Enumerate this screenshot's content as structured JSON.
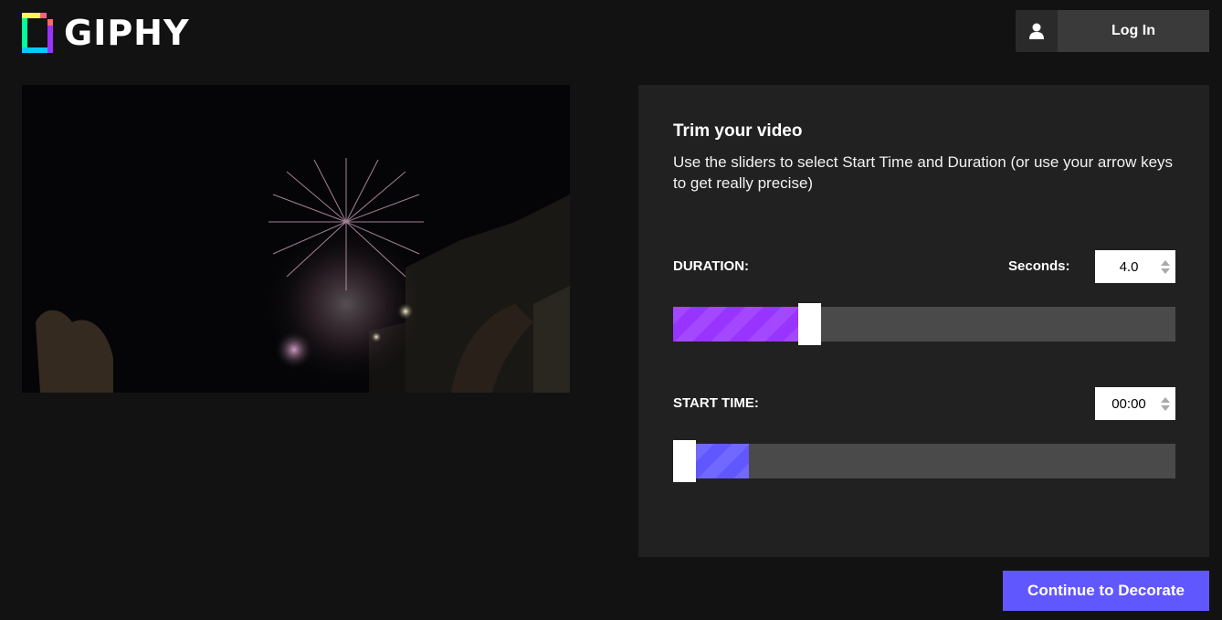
{
  "header": {
    "logo_text": "GIPHY",
    "login_label": "Log In",
    "login_icon": "user-icon"
  },
  "video": {
    "description_icon": "fireworks-video-preview"
  },
  "trim_panel": {
    "title": "Trim your video",
    "description": "Use the sliders to select Start Time and Duration (or use your arrow keys to get really precise)",
    "duration": {
      "label": "DURATION:",
      "seconds_label": "Seconds:",
      "value": "4.0",
      "fraction_selected": 0.25,
      "fill_color": "#9933ff"
    },
    "start_time": {
      "label": "START TIME:",
      "value": "00:00",
      "window_fraction": 0.15,
      "fill_color": "#6157ff"
    }
  },
  "footer": {
    "continue_label": "Continue to Decorate"
  },
  "colors": {
    "background": "#121212",
    "panel": "#212121",
    "accent": "#6157ff"
  }
}
